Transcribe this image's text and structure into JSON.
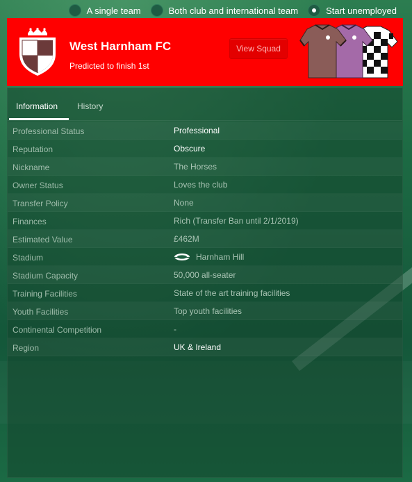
{
  "mode_options": [
    {
      "label": "A single team",
      "checked": false
    },
    {
      "label": "Both club and international team",
      "checked": false
    },
    {
      "label": "Start unemployed",
      "checked": true
    }
  ],
  "club": {
    "name": "West Harnham FC",
    "prediction": "Predicted to finish 1st",
    "view_squad_label": "View Squad",
    "header_color": "#ff0000"
  },
  "tabs": [
    {
      "label": "Information",
      "active": true
    },
    {
      "label": "History",
      "active": false
    }
  ],
  "info_rows": [
    {
      "label": "Professional Status",
      "value": "Professional"
    },
    {
      "label": "Reputation",
      "value": "Obscure"
    },
    {
      "label": "Nickname",
      "value": "The Horses"
    },
    {
      "label": "Owner Status",
      "value": "Loves the club"
    },
    {
      "label": "Transfer Policy",
      "value": "None"
    },
    {
      "label": "Finances",
      "value": "Rich (Transfer Ban until 2/1/2019)"
    },
    {
      "label": "Estimated Value",
      "value": "£462M"
    },
    {
      "label": "Stadium",
      "value": "Harnham Hill"
    },
    {
      "label": "Stadium Capacity",
      "value": "50,000 all-seater"
    },
    {
      "label": "Training Facilities",
      "value": "State of the art training facilities"
    },
    {
      "label": "Youth Facilities",
      "value": "Top youth facilities"
    },
    {
      "label": "Continental Competition",
      "value": "-"
    },
    {
      "label": "Region",
      "value": "UK & Ireland"
    }
  ]
}
